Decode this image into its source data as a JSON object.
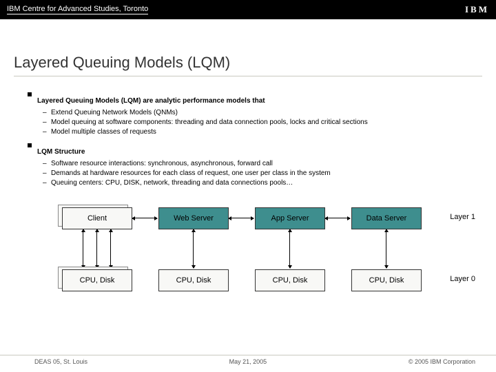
{
  "header": {
    "org": "IBM Centre for Advanced Studies, Toronto",
    "logo_alt": "IBM"
  },
  "title": "Layered Queuing Models (LQM)",
  "sections": [
    {
      "heading": "Layered Queuing Models (LQM) are  analytic performance models that",
      "items": [
        "Extend Queuing Network Models (QNMs)",
        "Model queuing at software components: threading and data connection pools, locks and critical sections",
        "Model multiple classes of requests"
      ]
    },
    {
      "heading": "LQM Structure",
      "items": [
        "Software resource interactions: synchronous, asynchronous, forward call",
        "Demands at hardware resources for each class of request, one user per class in the system",
        "Queuing centers: CPU, DISK, network, threading and data connections pools…"
      ]
    }
  ],
  "diagram": {
    "layer1": [
      "Client",
      "Web Server",
      "App Server",
      "Data Server"
    ],
    "layer0": [
      "CPU, Disk",
      "CPU, Disk",
      "CPU, Disk",
      "CPU, Disk"
    ],
    "labels": {
      "top": "Layer 1",
      "bottom": "Layer 0"
    }
  },
  "footer": {
    "left": "DEAS 05, St. Louis",
    "center": "May 21, 2005",
    "right": "© 2005 IBM Corporation"
  }
}
